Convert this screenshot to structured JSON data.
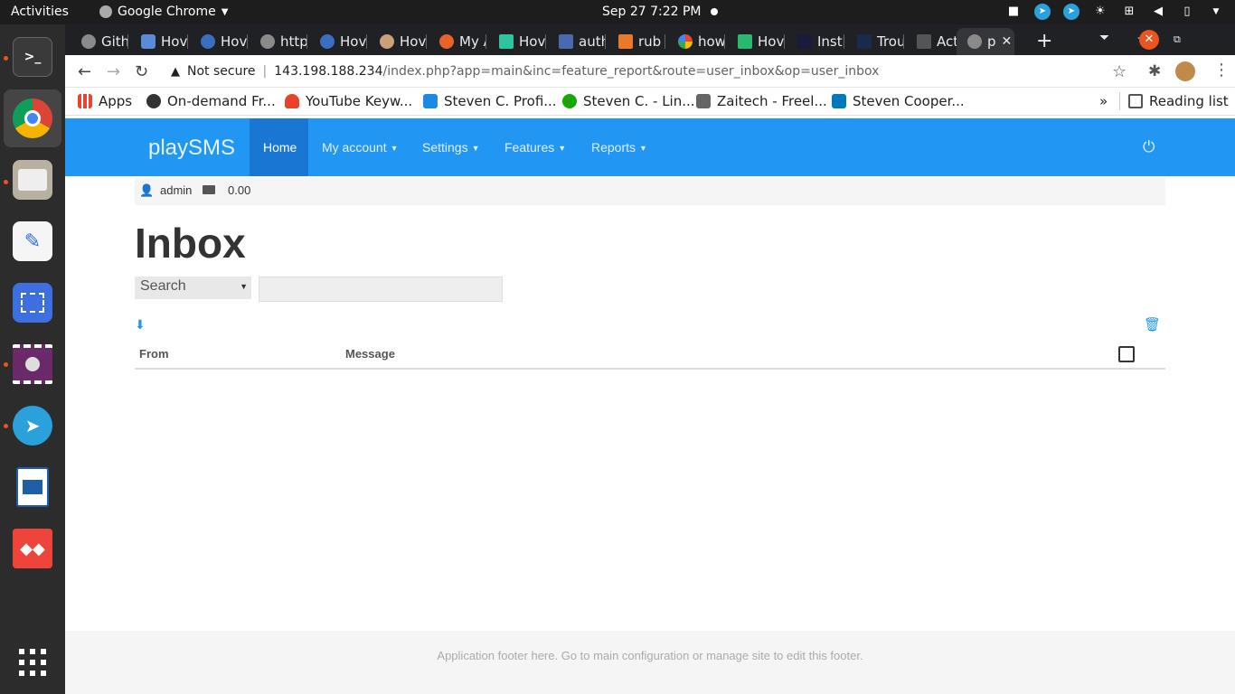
{
  "desktop": {
    "activities_label": "Activities",
    "app_name": "Google Chrome",
    "clock": "Sep 27   7:22 PM"
  },
  "dock": {
    "items": [
      "terminal",
      "chrome",
      "files",
      "text-editor",
      "screenshot",
      "video",
      "telegram",
      "writer",
      "anydesk",
      "app-grid"
    ]
  },
  "browser": {
    "tabs": [
      {
        "label": "Gith"
      },
      {
        "label": "Hov"
      },
      {
        "label": "Hov"
      },
      {
        "label": "http"
      },
      {
        "label": "Hov"
      },
      {
        "label": "Hov"
      },
      {
        "label": "My A"
      },
      {
        "label": "Hov"
      },
      {
        "label": "auth"
      },
      {
        "label": "rub"
      },
      {
        "label": "how"
      },
      {
        "label": "Hov"
      },
      {
        "label": "Inst"
      },
      {
        "label": "Trou"
      },
      {
        "label": "Acti"
      },
      {
        "label": "p"
      }
    ],
    "not_secure_label": "Not secure",
    "url_host": "143.198.188.234",
    "url_path": "/index.php?app=main&inc=feature_report&route=user_inbox&op=user_inbox",
    "bookmarks": [
      {
        "label": "Apps"
      },
      {
        "label": "On-demand Fr..."
      },
      {
        "label": "YouTube Keyw..."
      },
      {
        "label": "Steven C. Profi..."
      },
      {
        "label": "Steven C. - Lin..."
      },
      {
        "label": "Zaitech - Freel..."
      },
      {
        "label": "Steven Cooper..."
      }
    ],
    "more_label": "»",
    "reading_list_label": "Reading list"
  },
  "navbar": {
    "brand": "playSMS",
    "items": [
      {
        "label": "Home"
      },
      {
        "label": "My account"
      },
      {
        "label": "Settings"
      },
      {
        "label": "Features"
      },
      {
        "label": "Reports"
      }
    ],
    "accent": "#2196f3"
  },
  "userbar": {
    "username": "admin",
    "credit": "0.00"
  },
  "page": {
    "title": "Inbox",
    "search_select_value": "Search",
    "search_input_value": "",
    "columns": [
      "From",
      "Message"
    ]
  },
  "footer": {
    "text": "Application footer here. Go to main configuration or manage site to edit this footer."
  }
}
